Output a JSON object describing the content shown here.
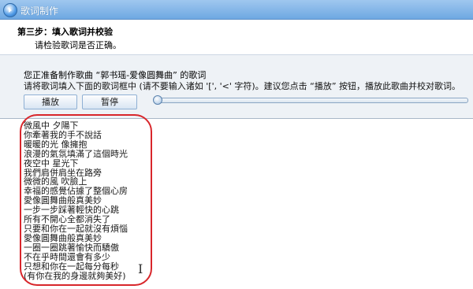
{
  "window": {
    "title": "歌词制作"
  },
  "step": {
    "title": "第三步：填入歌词并校验",
    "subtitle": "请检验歌词是否正确。"
  },
  "prompt": {
    "line1": "您正准备制作歌曲 “郭书瑶-爱像圆舞曲” 的歌词",
    "line2": "请将歌词填入下面的歌词框中 (请不要输入诸如 '[', '<' 字符)。建议您点击 “播放” 按钮，播放此歌曲并校对歌词。"
  },
  "controls": {
    "play_label": "播放",
    "pause_label": "暂停",
    "progress": 0
  },
  "lyrics": [
    "微風中 夕陽下",
    "你牽著我的手不說話",
    "暖暖的光 像擁抱",
    "浪漫的氣氛填滿了這個時光",
    "夜空中 星光下",
    "我們肩併肩坐在路旁",
    "微微的風 吹臉上",
    "幸福的感覺佔據了整個心房",
    "愛像圓舞曲般真美妙",
    "一步一步踩著輕快的心跳",
    "所有不開心全都消失了",
    "只要和你在一起就沒有煩惱",
    "愛像圓舞曲般真美妙",
    "一圈一圈跳著愉快而驕傲",
    "不在乎時間還會有多少",
    "只想和你在一起每分每秒",
    "(有你在我的身邊就夠美好)"
  ],
  "colors": {
    "accent": "#6ea8e2",
    "highlight": "#d8262b"
  },
  "icons": {
    "app": "app-logo-icon",
    "cursor": "text-cursor-icon"
  }
}
